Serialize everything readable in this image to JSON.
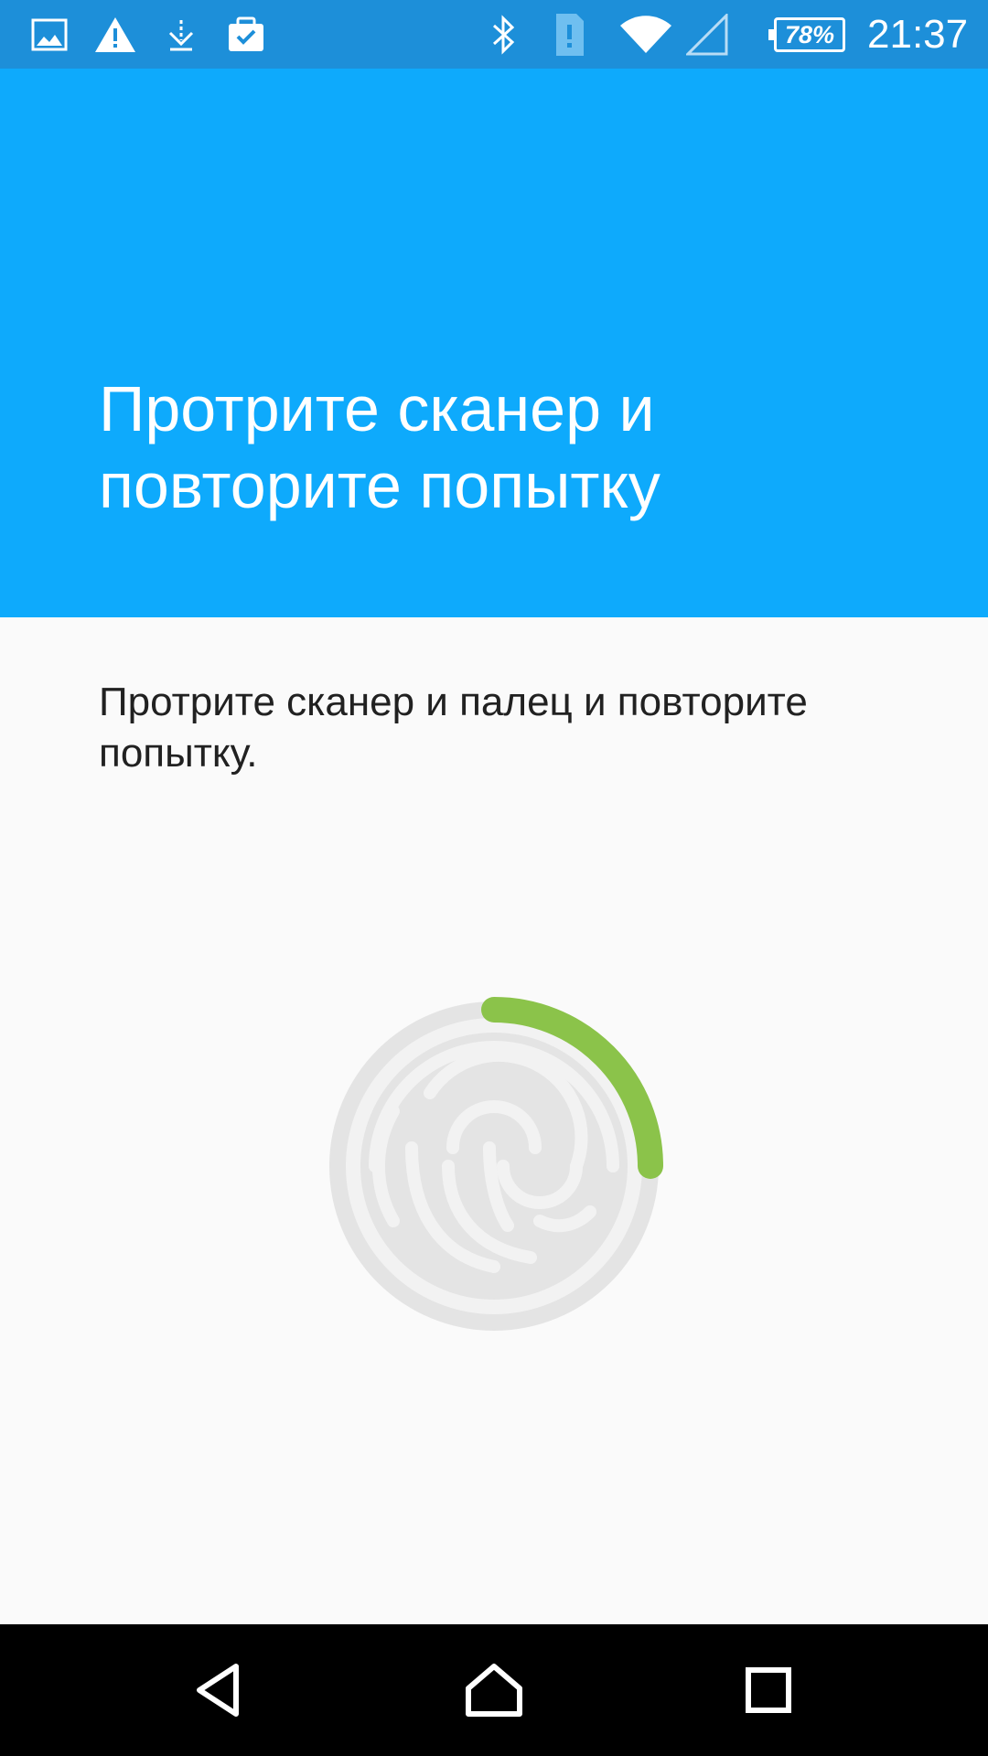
{
  "status_bar": {
    "icons": [
      "image-icon",
      "warning-icon",
      "download-icon",
      "clipboard-check-icon",
      "bluetooth-icon",
      "sim-alert-icon",
      "wifi-icon",
      "signal-icon"
    ],
    "battery": "78%",
    "time": "21:37"
  },
  "header": {
    "title": "Протрите сканер и повторите попытку"
  },
  "body": {
    "message": "Протрите сканер и палец и повторите попытку.",
    "progress_fraction": 0.25
  },
  "nav_bar": {
    "icons": [
      "back-icon",
      "home-icon",
      "recents-icon"
    ]
  },
  "colors": {
    "status_bar": "#1d8fd9",
    "header": "#0eaafc",
    "progress": "#8bc34a",
    "ring": "#e0e0e0"
  }
}
